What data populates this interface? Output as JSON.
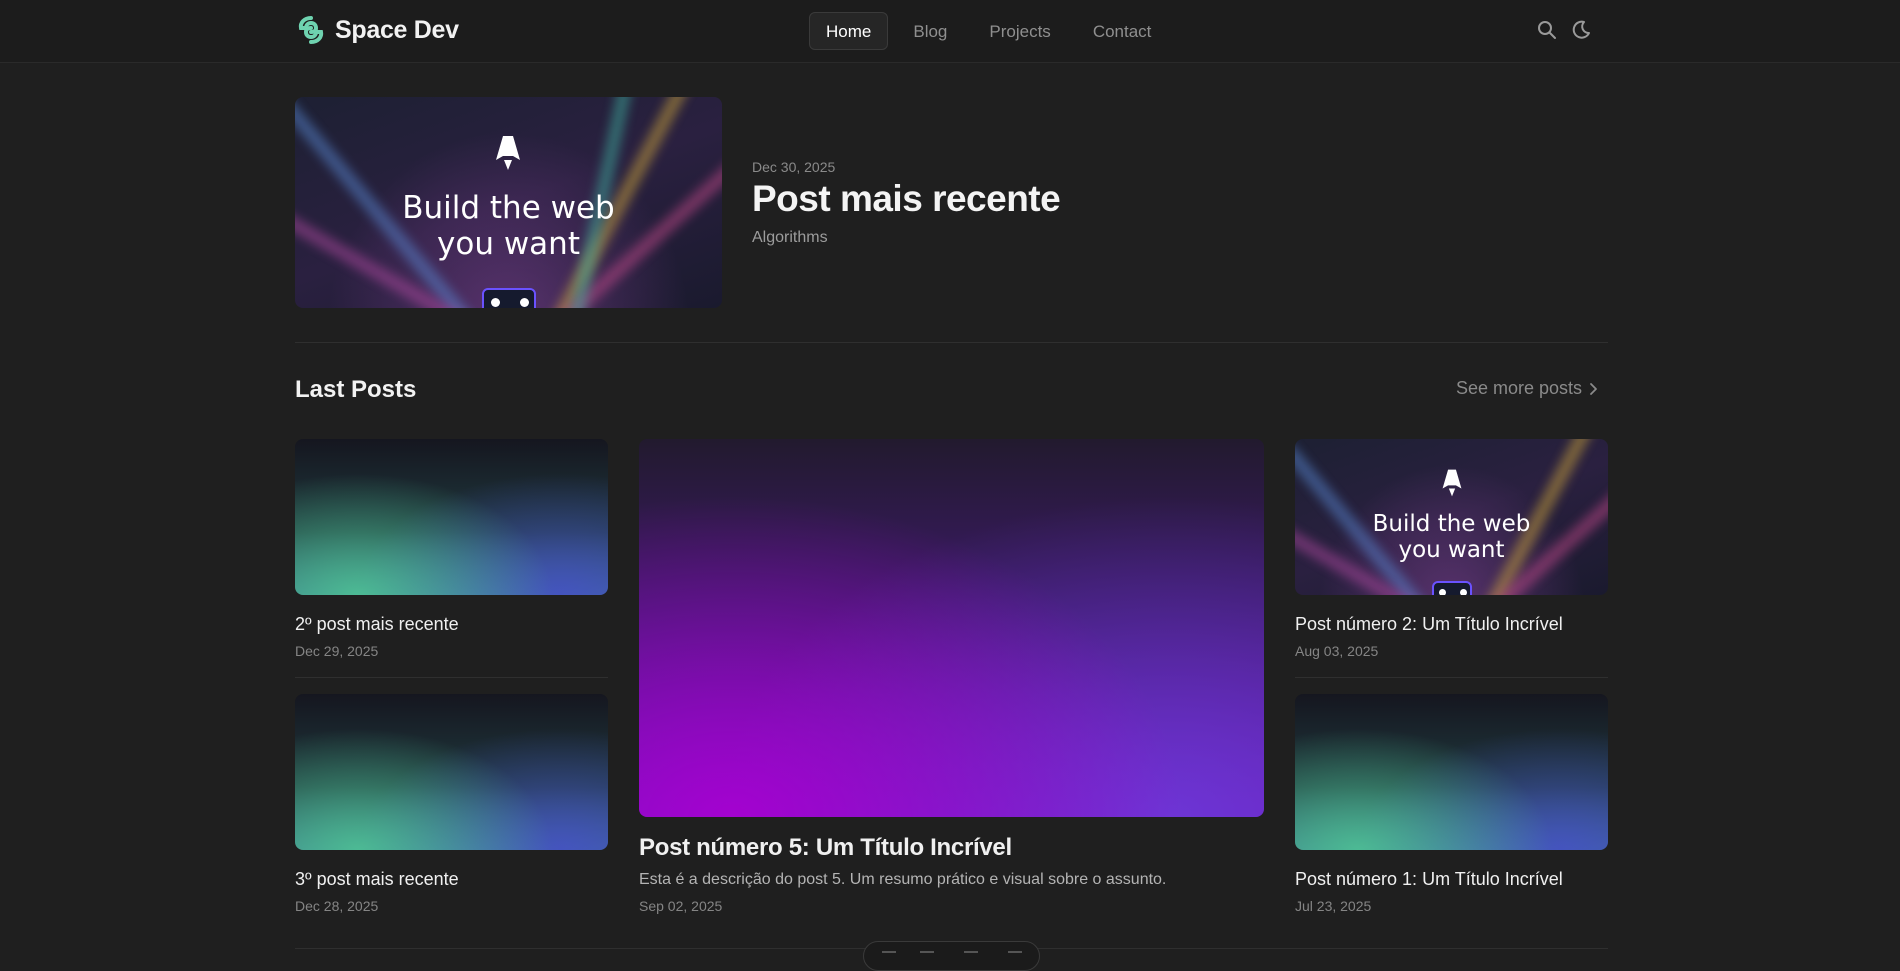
{
  "site": {
    "name": "Space Dev"
  },
  "nav": {
    "items": [
      {
        "label": "Home",
        "active": true
      },
      {
        "label": "Blog",
        "active": false
      },
      {
        "label": "Projects",
        "active": false
      },
      {
        "label": "Contact",
        "active": false
      }
    ],
    "icons": [
      "search-icon",
      "moon-icon"
    ]
  },
  "featured": {
    "date": "Dec 30, 2025",
    "title": "Post mais recente",
    "tag": "Algorithms",
    "image": {
      "line1": "Build the web",
      "line2": "you want"
    }
  },
  "section": {
    "title": "Last Posts",
    "see_more": "See more posts"
  },
  "posts": {
    "p2": {
      "title": "2º post mais recente",
      "date": "Dec 29, 2025"
    },
    "p3": {
      "title": "3º post mais recente",
      "date": "Dec 28, 2025"
    },
    "p5": {
      "title": "Post número 5: Um Título Incrível",
      "description": "Esta é a descrição do post 5. Um resumo prático e visual sobre o assunto.",
      "date": "Sep 02, 2025"
    },
    "n2": {
      "title": "Post número 2: Um Título Incrível",
      "date": "Aug 03, 2025",
      "image": {
        "line1": "Build the web",
        "line2": "you want"
      }
    },
    "n1": {
      "title": "Post número 1: Um Título Incrível",
      "date": "Jul 23, 2025"
    }
  },
  "colors": {
    "background": "#1f1f1f",
    "accent_logo": "#6fd3b0",
    "text": "#f0f0f0",
    "muted": "#858585"
  }
}
